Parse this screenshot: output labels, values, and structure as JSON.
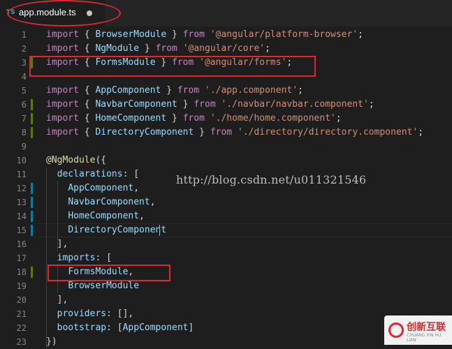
{
  "tab": {
    "lang_badge": "TS",
    "title": "app.module.ts"
  },
  "lines": [
    {
      "num": "1",
      "tokens": [
        [
          "kw",
          "import"
        ],
        [
          "p",
          " { "
        ],
        [
          "id",
          "BrowserModule"
        ],
        [
          "p",
          " } "
        ],
        [
          "kw",
          "from"
        ],
        [
          "p",
          " "
        ],
        [
          "str",
          "'@angular/platform-browser'"
        ],
        [
          "p",
          ";"
        ]
      ]
    },
    {
      "num": "2",
      "tokens": [
        [
          "kw",
          "import"
        ],
        [
          "p",
          " { "
        ],
        [
          "id",
          "NgModule"
        ],
        [
          "p",
          " } "
        ],
        [
          "kw",
          "from"
        ],
        [
          "p",
          " "
        ],
        [
          "str",
          "'@angular/core'"
        ],
        [
          "p",
          ";"
        ]
      ]
    },
    {
      "num": "3",
      "tokens": [
        [
          "kw",
          "import"
        ],
        [
          "p",
          " { "
        ],
        [
          "id",
          "FormsModule"
        ],
        [
          "p",
          " } "
        ],
        [
          "kw",
          "from"
        ],
        [
          "p",
          " "
        ],
        [
          "str",
          "'@angular/forms'"
        ],
        [
          "p",
          ";"
        ]
      ]
    },
    {
      "num": "4",
      "tokens": []
    },
    {
      "num": "5",
      "tokens": [
        [
          "kw",
          "import"
        ],
        [
          "p",
          " { "
        ],
        [
          "id",
          "AppComponent"
        ],
        [
          "p",
          " } "
        ],
        [
          "kw",
          "from"
        ],
        [
          "p",
          " "
        ],
        [
          "str",
          "'./app.component'"
        ],
        [
          "p",
          ";"
        ]
      ]
    },
    {
      "num": "6",
      "tokens": [
        [
          "kw",
          "import"
        ],
        [
          "p",
          " { "
        ],
        [
          "id",
          "NavbarComponent"
        ],
        [
          "p",
          " } "
        ],
        [
          "kw",
          "from"
        ],
        [
          "p",
          " "
        ],
        [
          "str",
          "'./navbar/navbar.component'"
        ],
        [
          "p",
          ";"
        ]
      ]
    },
    {
      "num": "7",
      "tokens": [
        [
          "kw",
          "import"
        ],
        [
          "p",
          " { "
        ],
        [
          "id",
          "HomeComponent"
        ],
        [
          "p",
          " } "
        ],
        [
          "kw",
          "from"
        ],
        [
          "p",
          " "
        ],
        [
          "str",
          "'./home/home.component'"
        ],
        [
          "p",
          ";"
        ]
      ]
    },
    {
      "num": "8",
      "tokens": [
        [
          "kw",
          "import"
        ],
        [
          "p",
          " { "
        ],
        [
          "id",
          "DirectoryComponent"
        ],
        [
          "p",
          " } "
        ],
        [
          "kw",
          "from"
        ],
        [
          "p",
          " "
        ],
        [
          "str",
          "'./directory/directory.component'"
        ],
        [
          "p",
          ";"
        ]
      ]
    },
    {
      "num": "9",
      "tokens": []
    },
    {
      "num": "10",
      "tokens": [
        [
          "fn",
          "@NgModule"
        ],
        [
          "p",
          "({"
        ]
      ]
    },
    {
      "num": "11",
      "tokens": [
        [
          "p",
          "  "
        ],
        [
          "id",
          "declarations"
        ],
        [
          "p",
          ": ["
        ]
      ]
    },
    {
      "num": "12",
      "tokens": [
        [
          "p",
          "    "
        ],
        [
          "id",
          "AppComponent"
        ],
        [
          "p",
          ","
        ]
      ]
    },
    {
      "num": "13",
      "tokens": [
        [
          "p",
          "    "
        ],
        [
          "id",
          "NavbarComponent"
        ],
        [
          "p",
          ","
        ]
      ]
    },
    {
      "num": "14",
      "tokens": [
        [
          "p",
          "    "
        ],
        [
          "id",
          "HomeComponent"
        ],
        [
          "p",
          ","
        ]
      ]
    },
    {
      "num": "15",
      "tokens": [
        [
          "p",
          "    "
        ],
        [
          "id",
          "DirectoryComponent"
        ]
      ]
    },
    {
      "num": "16",
      "tokens": [
        [
          "p",
          "  ],"
        ]
      ]
    },
    {
      "num": "17",
      "tokens": [
        [
          "p",
          "  "
        ],
        [
          "id",
          "imports"
        ],
        [
          "p",
          ": ["
        ]
      ]
    },
    {
      "num": "18",
      "tokens": [
        [
          "p",
          "    "
        ],
        [
          "id",
          "FormsModule"
        ],
        [
          "p",
          ","
        ]
      ]
    },
    {
      "num": "19",
      "tokens": [
        [
          "p",
          "    "
        ],
        [
          "id",
          "BrowserModule"
        ]
      ]
    },
    {
      "num": "20",
      "tokens": [
        [
          "p",
          "  ],"
        ]
      ]
    },
    {
      "num": "21",
      "tokens": [
        [
          "p",
          "  "
        ],
        [
          "id",
          "providers"
        ],
        [
          "p",
          ": [],"
        ]
      ]
    },
    {
      "num": "22",
      "tokens": [
        [
          "p",
          "  "
        ],
        [
          "id",
          "bootstrap"
        ],
        [
          "p",
          ": ["
        ],
        [
          "id",
          "AppComponent"
        ],
        [
          "p",
          "]"
        ]
      ]
    },
    {
      "num": "23",
      "tokens": [
        [
          "p",
          "})"
        ]
      ]
    }
  ],
  "gutter_marks": {
    "3": "green",
    "6": "green",
    "7": "green",
    "8": "green",
    "12": "blue",
    "13": "blue",
    "14": "blue",
    "15": "blue",
    "18": "green"
  },
  "watermark": "http://blog.csdn.net/u011321546",
  "logo": {
    "text": "创新互联",
    "sub": "CHUANG XIN HU LIAN"
  },
  "colors": {
    "keyword": "#c586c0",
    "string": "#ce9178",
    "identifier": "#9cdcfe",
    "decorator": "#dcdcaa",
    "highlight": "#e0282e"
  }
}
